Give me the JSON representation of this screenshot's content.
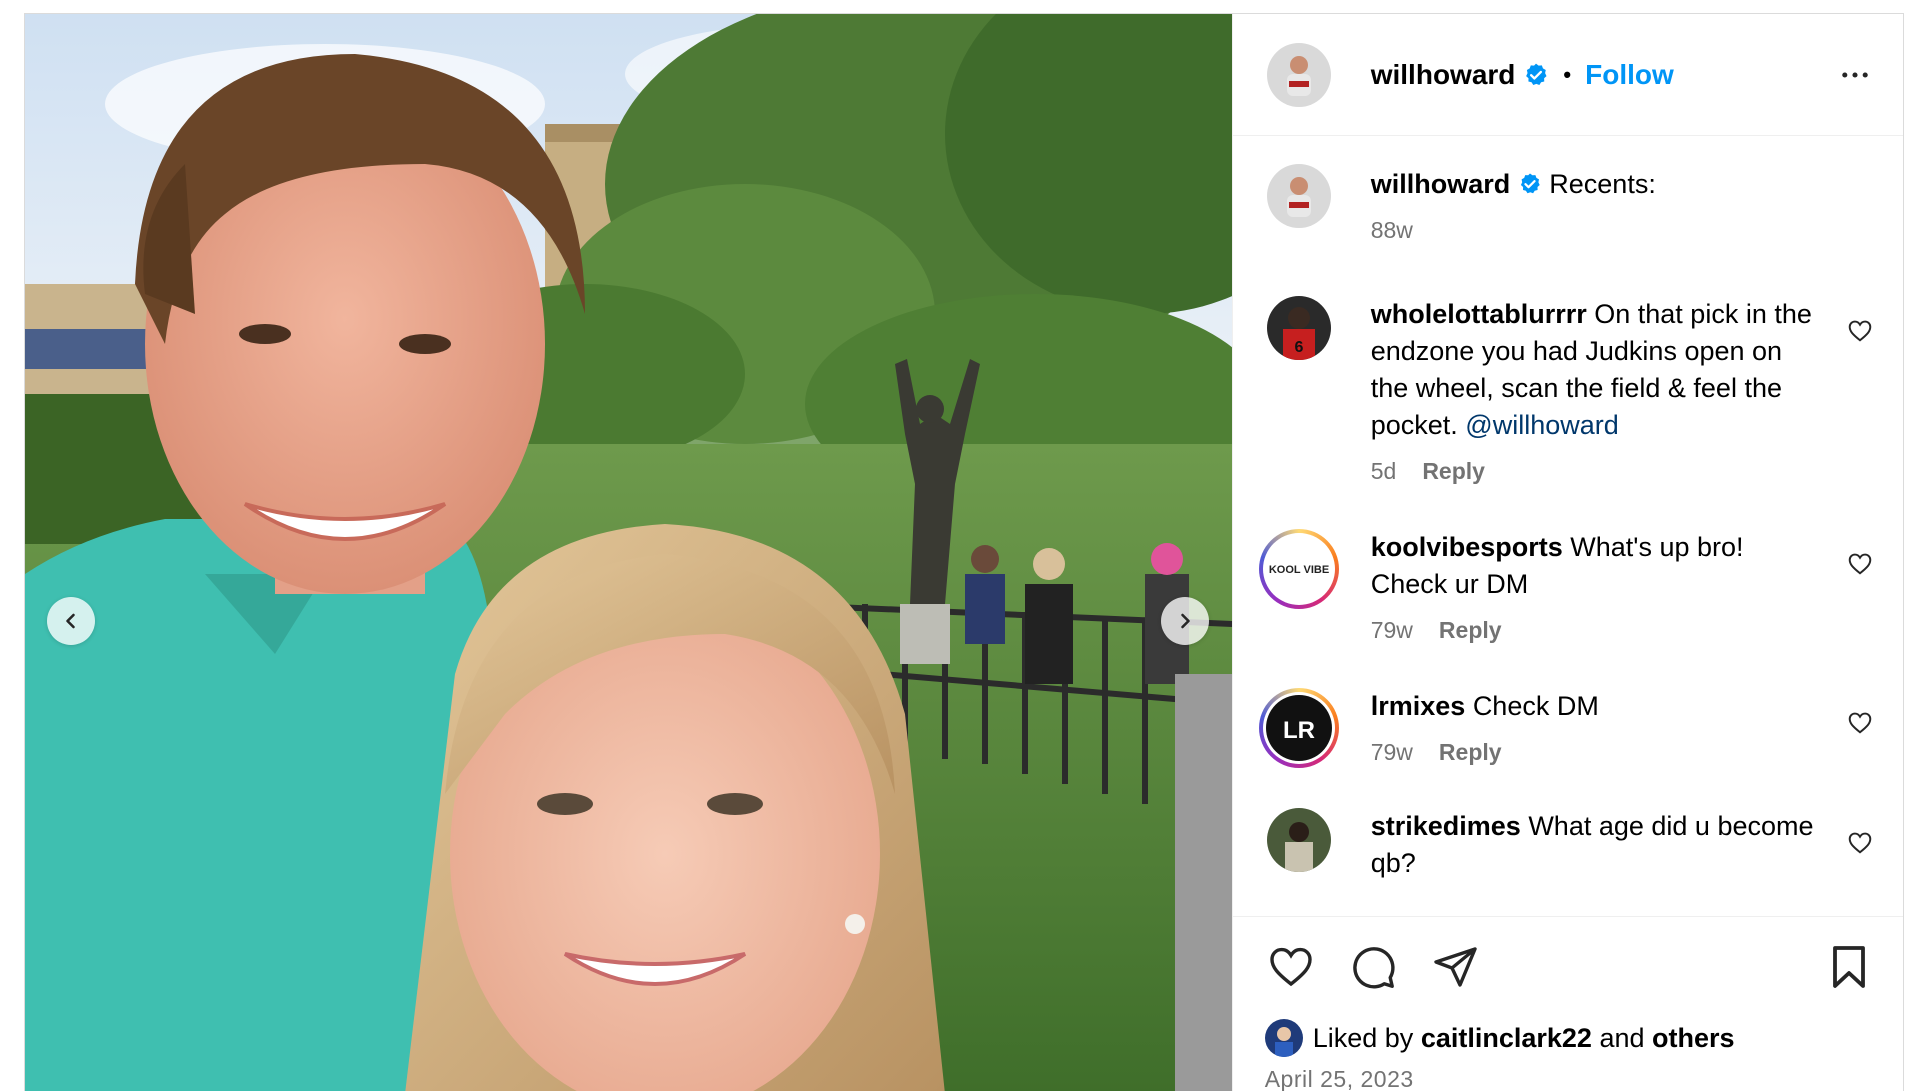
{
  "post": {
    "author": {
      "username": "willhoward",
      "verified": true,
      "follow_label": "Follow",
      "separator": "•"
    },
    "caption": {
      "username": "willhoward",
      "text": "Recents:",
      "age": "88w"
    },
    "comments": [
      {
        "username": "wholelottablurrrr",
        "text_before": "On that pick in the endzone you had Judkins open on the wheel, scan the field & feel the pocket.",
        "mention": "@willhoward",
        "age": "5d",
        "reply_label": "Reply"
      },
      {
        "username": "koolvibesports",
        "text_before": "What's up bro! Check ur DM",
        "mention": "",
        "age": "79w",
        "reply_label": "Reply",
        "avatar_text": "KOOL VIBE"
      },
      {
        "username": "lrmixes",
        "text_before": "Check DM",
        "mention": "",
        "age": "79w",
        "reply_label": "Reply",
        "avatar_text": "LR"
      },
      {
        "username": "strikedimes",
        "text_before": "What age did u become qb?",
        "mention": "",
        "age": "",
        "reply_label": ""
      }
    ],
    "likes": {
      "prefix": "Liked by",
      "user": "caitlinclark22",
      "middle": "and",
      "others": "others"
    },
    "date": "April 25, 2023",
    "colors": {
      "follow": "#0095f6",
      "verified": "#0095f6",
      "mention": "#00376b",
      "muted": "#737373"
    },
    "icons": [
      "chevron-left-icon",
      "chevron-right-icon",
      "more-icon",
      "verified-badge-icon",
      "heart-icon",
      "comment-icon",
      "share-icon",
      "bookmark-icon"
    ]
  }
}
